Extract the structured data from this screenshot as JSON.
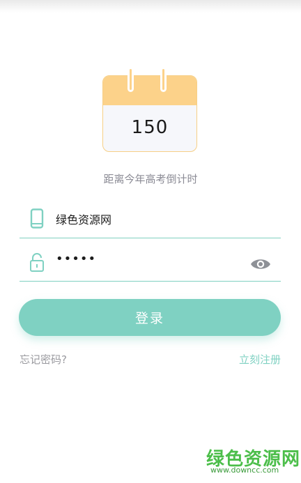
{
  "countdown": {
    "days": "150",
    "caption": "距离今年高考倒计时"
  },
  "login": {
    "username_value": "绿色资源网",
    "password_mask": "•••••",
    "submit_label": "登录",
    "forgot_label": "忘记密码?",
    "register_label": "立刻注册"
  },
  "icons": {
    "phone": "phone-icon",
    "lock": "lock-icon",
    "eye": "eye-icon",
    "calendar": "calendar-icon"
  },
  "colors": {
    "accent": "#7fd1c2",
    "calendar_header": "#fcd28a"
  },
  "watermark": {
    "title": "绿色资源网",
    "url": "www.downcc.com"
  }
}
